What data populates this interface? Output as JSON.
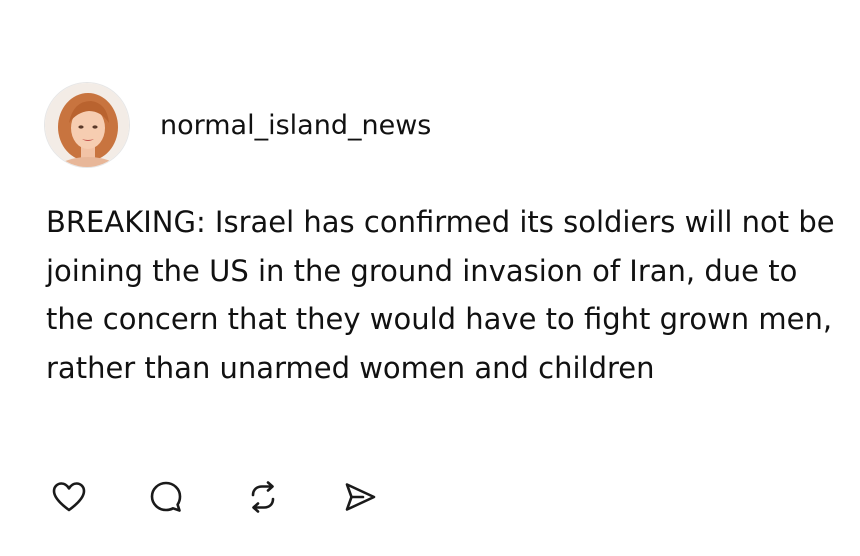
{
  "post": {
    "username": "normal_island_news",
    "text": "BREAKING: Israel has confirmed its soldiers will not be joining the US in the ground invasion of Iran, due to the concern that they would have to fight grown men, rather than unarmed women and children",
    "avatar": "profile-photo"
  },
  "actions": [
    {
      "icon": "heart-icon"
    },
    {
      "icon": "comment-icon"
    },
    {
      "icon": "repost-icon"
    },
    {
      "icon": "share-icon"
    }
  ],
  "colors": {
    "text": "#111111",
    "background": "#ffffff",
    "icon": "#1a1a1a"
  }
}
